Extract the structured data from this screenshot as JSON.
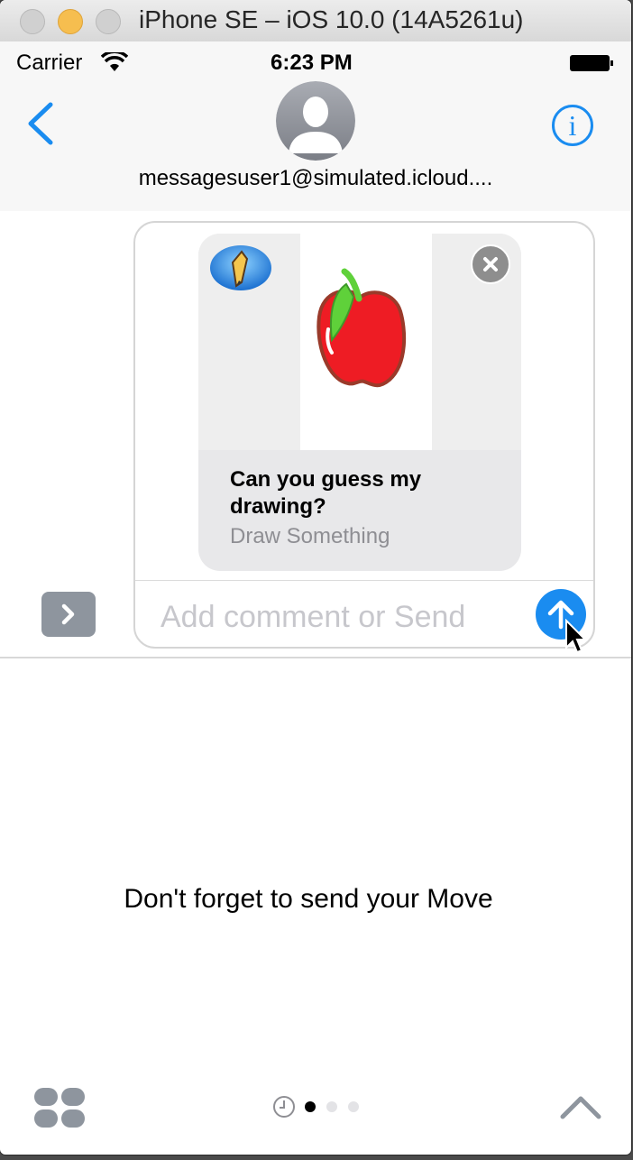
{
  "window": {
    "title": "iPhone SE – iOS 10.0 (14A5261u)"
  },
  "status_bar": {
    "carrier": "Carrier",
    "time": "6:23 PM"
  },
  "nav": {
    "contact": "messagesuser1@simulated.icloud...."
  },
  "card": {
    "caption": "Can you guess my drawing?",
    "app_name": "Draw Something"
  },
  "composer": {
    "placeholder": "Add comment or Send"
  },
  "drawer": {
    "message": "Don't forget to send your Move"
  },
  "page_indicator": {
    "pages": 3,
    "current": 1
  },
  "colors": {
    "accent": "#1a8cf0",
    "apple_red": "#ee1c24",
    "leaf_green": "#5fd13a"
  }
}
